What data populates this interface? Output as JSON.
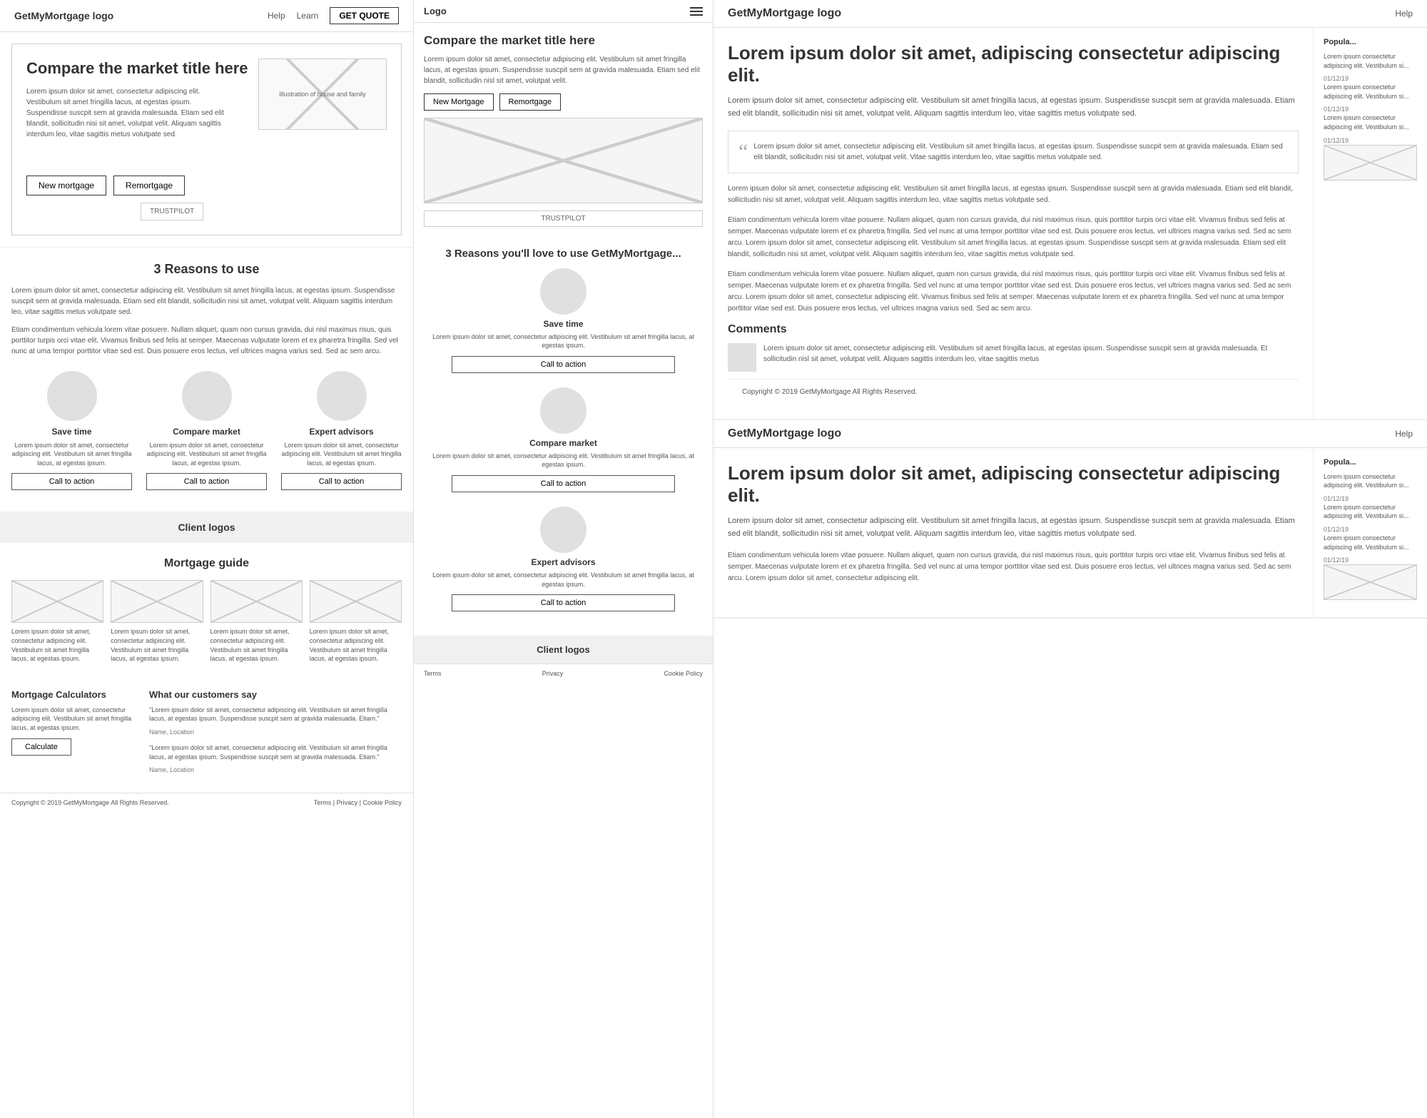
{
  "col1": {
    "header": {
      "logo": "GetMyMortgage logo",
      "nav": {
        "help": "Help",
        "learn": "Learn",
        "get_quote": "GET QUOTE"
      }
    },
    "hero": {
      "title": "Compare the market title here",
      "text": "Lorem ipsum dolor sit amet, consectetur adipiscing elit. Vestibulum sit amet fringilla lacus, at egestas ipsum. Suspendisse suscpit sem at gravida malesuada. Etiam sed elit blandit, sollicitudin nisi sit amet, volutpat velit. Aliquam sagittis interdum leo, vitae sagittis metus volutpate sed.",
      "illustration_label": "Illustration of house and family",
      "btn_new_mortgage": "New mortgage",
      "btn_remortgage": "Remortgage",
      "trustpilot": "TRUSTPILOT"
    },
    "reasons": {
      "title": "3 Reasons to use",
      "text": "Lorem ipsum dolor sit amet, consectetur adipiscing elit. Vestibulum sit amet fringilla lacus, at egestas ipsum. Suspendisse suscpit sem at gravida malesuada. Etiam sed elit blandit, sollicitudin nisi sit amet, volutpat velit. Aliquam sagittis interdum leo, vitae sagittis metus volutpate sed.",
      "subtext": "Etiam condimentum vehicula lorem vitae posuere. Nullam aliquet, quam non cursus gravida, dui nisl maximus risus, quis porttitor turpis orci vitae elit. Vivamus finibus sed felis at semper. Maecenas vulputate lorem et ex pharetra fringilla. Sed vel nunc at uma tempor porttitor vitae sed est. Duis posuere eros lectus, vel ultrices magna varius sed. Sed ac sem arcu.",
      "cards": [
        {
          "title": "Save time",
          "text": "Lorem ipsum dolor sit amet, consectetur adipiscing elit. Vestibulum sit amet fringilla lacus, at egestas ipsum.",
          "cta": "Call to action"
        },
        {
          "title": "Compare market",
          "text": "Lorem ipsum dolor sit amet, consectetur adipiscing elit. Vestibulum sit amet fringilla lacus, at egestas ipsum.",
          "cta": "Call to action"
        },
        {
          "title": "Expert advisors",
          "text": "Lorem ipsum dolor sit amet, consectetur adipiscing elit. Vestibulum sit amet fringilla lacus, at egestas ipsum.",
          "cta": "Call to action"
        }
      ]
    },
    "client_logos": {
      "title": "Client logos"
    },
    "mortgage_guide": {
      "title": "Mortgage guide",
      "cards": [
        {
          "text": "Lorem ipsum dolor sit amet, consectetur adipiscing elit. Vestibulum sit amet fringilla lacus, at egestas ipsum."
        },
        {
          "text": "Lorem ipsum dolor sit amet, consectetur adipiscing elit. Vestibulum sit amet fringilla lacus, at egestas ipsum."
        },
        {
          "text": "Lorem ipsum dolor sit amet, consectetur adipiscing elit. Vestibulum sit amet fringilla lacus, at egestas ipsum."
        },
        {
          "text": "Lorem ipsum dolor sit amet, consectetur adipiscing elit. Vestibulum sit amet fringilla lacus, at egestas ipsum."
        }
      ]
    },
    "calculators": {
      "title": "Mortgage Calculators",
      "text": "Lorem ipsum dolor sit amet, consectetur adipiscing elit. Vestibulum sit amet fringilla lacus, at egestas ipsum.",
      "btn": "Calculate"
    },
    "testimonials": {
      "title": "What our customers say",
      "items": [
        {
          "text": "\"Lorem ipsum dolor sit amet, consectetur adipiscing elit. Vestibulum sit amet fringilla lacus, at egestas ipsum. Suspendisse suscpit sem at gravida malesuada. Etiam.\"",
          "author": "Name, Location"
        },
        {
          "text": "\"Lorem ipsum dolor sit amet, consectetur adipiscing elit. Vestibulum sit amet fringilla lacus, at egestas ipsum. Suspendisse suscpit sem at gravida malesuada. Etiam.\"",
          "author": "Name, Location"
        }
      ]
    },
    "footer": {
      "copyright": "Copyright © 2019 GetMyMortgage All Rights Reserved.",
      "links": "Terms | Privacy | Cookie Policy"
    }
  },
  "col2": {
    "header": {
      "logo": "Logo",
      "menu_icon": "≡"
    },
    "hero": {
      "title": "Compare the market title here",
      "text": "Lorem ipsum dolor sit amet, consectetur adipiscing elit. Vestibulum sit amet fringilla lacus, at egestas ipsum. Suspendisse suscpit sem at gravida malesuada. Etiam sed elit blandit, sollicitudin nisl sit amet, volutpat velit.",
      "btn_new_mortgage": "New Mortgage",
      "btn_remortgage": "Remortgage",
      "trustpilot": "TRUSTPILOT"
    },
    "reasons": {
      "title": "3 Reasons you'll love to use GetMyMortgage...",
      "cards": [
        {
          "title": "Save time",
          "text": "Lorem ipsum dolor sit amet, consectetur adipiscing elit. Vestibulum sit amet fringilla lacus, at egestas ipsum.",
          "cta": "Call to action"
        },
        {
          "title": "Compare market",
          "text": "Lorem ipsum dolor sit amet, consectetur adipiscing elit. Vestibulum sit amet fringilla lacus, at egestas ipsum.",
          "cta": "Call to action"
        },
        {
          "title": "Expert advisors",
          "text": "Lorem ipsum dolor sit amet, consectetur adipiscing elit. Vestibulum sit amet fringilla lacus, at egestas ipsum.",
          "cta": "Call to action"
        }
      ]
    },
    "client_logos": {
      "title": "Client logos"
    },
    "footer": {
      "terms": "Terms",
      "privacy": "Privacy",
      "cookie": "Cookie Policy"
    }
  },
  "col3": {
    "part1": {
      "header": {
        "logo": "GetMyMortgage logo",
        "nav": "Help"
      },
      "sidebar": {
        "title": "Popula...",
        "items": [
          {
            "text": "Lorem ipsum consectetur adipiscing elit. Vestibulum si...",
            "date": "01/12/19"
          },
          {
            "text": "Lorem ipsum consectetur adipiscing elit. Vestibulum si...",
            "date": "01/12/19"
          },
          {
            "text": "Lorem ipsum consectetur adipiscing elit. Vestibulum si...",
            "date": "01/12/19"
          }
        ]
      },
      "main": {
        "title": "Lorem ipsum dolor sit amet, adipiscing consectetur adipiscing elit.",
        "text1": "Lorem ipsum dolor sit amet, consectetur adipiscing elit. Vestibulum sit amet fringilla lacus, at egestas ipsum. Suspendisse suscpit sem at gravida malesuada. Etiam sed elit blandit, sollicitudin nisi sit amet, volutpat velit. Aliquam sagittis interdum leo, vitae sagittis metus volutpate sed.",
        "quote": "Lorem ipsum dolor sit amet, consectetur adipiscing elit. Vestibulum sit amet fringilla lacus, at egestas ipsum. Suspendisse suscpit sem at gravida malesuada. Etiam sed elit blandit, sollicitudin nisi sit amet, volutpat velit. Vitae sagittis interdum leo, vitae sagittis metus volutpate sed.",
        "text2": "Lorem ipsum dolor sit amet, consectetur adipiscing elit. Vestibulum sit amet fringilla lacus, at egestas ipsum. Suspendisse suscpit sem at gravida malesuada. Etiam sed elit blandit, sollicitudin nisi sit amet, volutpat velit. Aliquam sagittis interdum leo, vitae sagittis metus volutpate sed.",
        "text3": "Etiam condimentum vehicula lorem vitae posuere. Nullam aliquet, quam non cursus gravida, dui nisl maximus risus, quis porttitor turpis orci vitae elit. Vivamus finibus sed felis at semper. Maecenas vulputate lorem et ex pharetra fringilla. Sed vel nunc at uma tempor porttitor vitae sed est. Duis posuere eros lectus, vel ultrices magna varius sed. Sed ac sem arcu. Lorem ipsum dolor sit amet, consectetur adipiscing elit. Vestibulum sit amet fringilla lacus, at egestas ipsum. Suspendisse suscpit sem at gravida malesuada. Etiam sed elit blandit, sollicitudin nisi sit amet, volutpat velit. Aliquam sagittis interdum leo, vitae sagittis metus volutpate sed.",
        "text4": "Etiam condimentum vehicula lorem vitae posuere. Nullam aliquet, quam non cursus gravida, dui nisl maximus risus, quis porttitor turpis orci vitae elit. Vivamus finibus sed felis at semper. Maecenas vulputate lorem et ex pharetra fringilla. Sed vel nunc at uma tempor porttitor vitae sed est. Duis posuere eros lectus, vel ultrices magna varius sed. Sed ac sem arcu. Lorem ipsum dolor sit amet, consectetur adipiscing elit. Vivamus finibus sed felis at semper. Maecenas vulputate lorem et ex pharetra fringilla. Sed vel nunc at uma tempor porttitor vitae sed est. Duis posuere eros lectus, vel ultrices magna varius sed. Sed ac sem arcu.",
        "comments_title": "Comments",
        "comment_text": "Lorem ipsum dolor sit amet, consectetur adipiscing elit. Vestibulum sit amet fringilla lacus, at egestas ipsum. Suspendisse suscpit sem at gravida malesuada. Et sollicitudin nisl sit amet, volutpat velit. Aliquam sagittis interdum leo, vitae sagittis metus",
        "copyright": "Copyright © 2019 GetMyMortgage All Rights Reserved."
      }
    },
    "part2": {
      "header": {
        "logo": "GetMyMortgage logo",
        "nav": "Help"
      },
      "sidebar": {
        "title": "Popula...",
        "items": [
          {
            "text": "Lorem ipsum consectetur adipiscing elit. Vestibulum si...",
            "date": "01/12/19"
          },
          {
            "text": "Lorem ipsum consectetur adipiscing elit. Vestibulum si...",
            "date": "01/12/19"
          },
          {
            "text": "Lorem ipsum consectetur adipiscing elit. Vestibulum si...",
            "date": "01/12/19"
          }
        ]
      },
      "main": {
        "title": "Lorem ipsum dolor sit amet, adipiscing consectetur adipiscing elit.",
        "text1": "Lorem ipsum dolor sit amet, consectetur adipiscing elit. Vestibulum sit amet fringilla lacus, at egestas ipsum. Suspendisse suscpit sem at gravida malesuada. Etiam sed elit blandit, sollicitudin nisi sit amet, volutpat velit. Aliquam sagittis interdum leo, vitae sagittis metus volutpate sed.",
        "text2": "Etiam condimentum vehicula lorem vitae posuere. Nullam aliquet, quam non cursus gravida, dui nisl maximus risus, quis porttitor turpis orci vitae elit. Vivamus finibus sed felis at semper. Maecenas vulputate lorem et ex pharetra fringilla. Sed vel nunc at uma tempor porttitor vitae sed est. Duis posuere eros lectus, vel ultrices magna varius sed. Sed ac sem arcu. Lorem ipsum dolor sit amet, consectetur adipiscing elit."
      }
    }
  }
}
